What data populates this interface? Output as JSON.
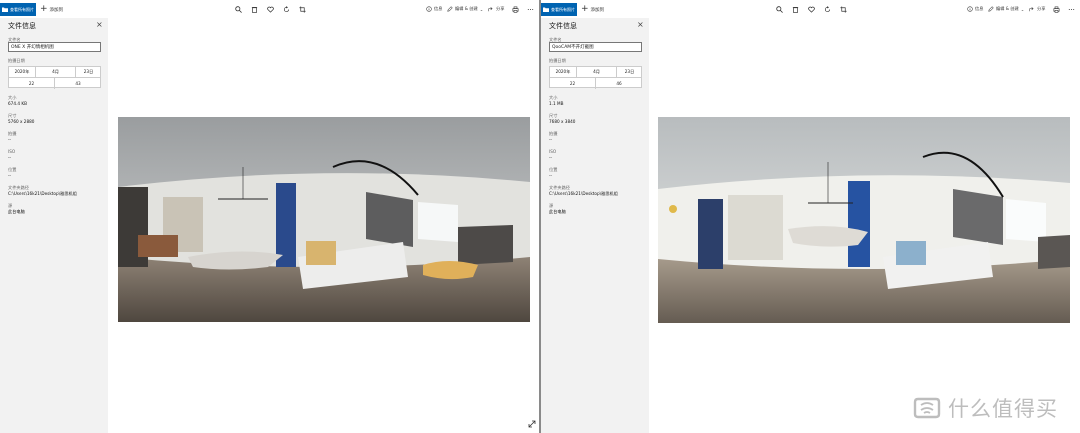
{
  "left_window": {
    "toolbar": {
      "collection_label": "查看所有照片",
      "add_label": "添加到",
      "edit_label": "编辑 & 创建",
      "share_label": "分享"
    },
    "panel": {
      "title": "文件信息",
      "filename_label": "文件名",
      "filename_value": "ONE X 开幻情相机图",
      "date_label": "拍摄日期",
      "year": "2020年",
      "month": "4月",
      "day": "23日",
      "hour": "22",
      "minute": "43",
      "size_label": "大小",
      "size_value": "674.4 KB",
      "dims_label": "尺寸",
      "dims_value": "5760 x 2880",
      "camera_label": "拍摄",
      "camera_value": "--",
      "iso_label": "ISO",
      "iso_value": "--",
      "location_label": "位置",
      "location_value": "--",
      "path_label": "文件夹路径",
      "path_value": "C:\\Users\\16k21\\Desktop\\雅思机组",
      "source_label": "源",
      "source_value": "此台电脑"
    }
  },
  "right_window": {
    "toolbar": {
      "collection_label": "查看所有照片",
      "add_label": "添加到",
      "edit_label": "编辑 & 创建",
      "share_label": "分享"
    },
    "panel": {
      "title": "文件信息",
      "filename_value": "QooCAM不开灯截图",
      "filename_label": "文件名",
      "date_label": "拍摄日期",
      "year": "2020年",
      "month": "4月",
      "day": "23日",
      "hour": "22",
      "minute": "46",
      "size_label": "大小",
      "size_value": "1.1 MB",
      "dims_label": "尺寸",
      "dims_value": "7680 x 3840",
      "camera_label": "拍摄",
      "camera_value": "--",
      "iso_label": "ISO",
      "iso_value": "--",
      "location_label": "位置",
      "location_value": "--",
      "path_label": "文件夹路径",
      "path_value": "C:\\Users\\16k21\\Desktop\\雅思机组",
      "source_label": "源",
      "source_value": "此台电脑"
    }
  },
  "watermark": {
    "text": "什么值得买"
  },
  "colors": {
    "accent": "#0063b1",
    "panel_bg": "#f2f2f2",
    "watermark": "#bdbdbd"
  }
}
